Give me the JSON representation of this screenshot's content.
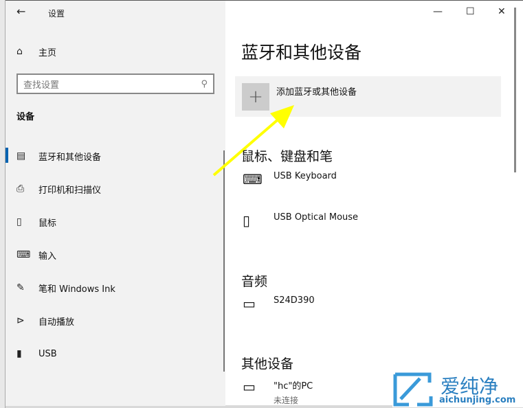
{
  "window": {
    "title": "设置",
    "controls": [
      "minimize",
      "maximize",
      "close"
    ]
  },
  "sidebar": {
    "home": "主页",
    "search_placeholder": "查找设置",
    "group": "设备",
    "items": [
      {
        "label": "蓝牙和其他设备",
        "icon": "bluetooth-devices-icon",
        "selected": true
      },
      {
        "label": "打印机和扫描仪",
        "icon": "printer-icon"
      },
      {
        "label": "鼠标",
        "icon": "mouse-icon"
      },
      {
        "label": "输入",
        "icon": "keyboard-icon"
      },
      {
        "label": "笔和 Windows Ink",
        "icon": "pen-icon"
      },
      {
        "label": "自动播放",
        "icon": "autoplay-icon"
      },
      {
        "label": "USB",
        "icon": "usb-icon"
      }
    ]
  },
  "main": {
    "title": "蓝牙和其他设备",
    "add_label": "添加蓝牙或其他设备",
    "sections": [
      {
        "title": "鼠标、键盘和笔",
        "devices": [
          {
            "name": "USB Keyboard",
            "icon": "keyboard-icon"
          },
          {
            "name": "USB Optical Mouse",
            "icon": "mouse-icon"
          }
        ]
      },
      {
        "title": "音频",
        "devices": [
          {
            "name": "S24D390",
            "icon": "monitor-icon"
          }
        ]
      },
      {
        "title": "其他设备",
        "devices": [
          {
            "name": "\"hc\"的PC",
            "status": "未连接",
            "icon": "wireless-display-icon"
          }
        ]
      }
    ]
  },
  "watermark": {
    "text": "爱纯净",
    "url": "aichunjing.com"
  },
  "colors": {
    "accent": "#0063b1",
    "arrow": "#ffff00"
  }
}
